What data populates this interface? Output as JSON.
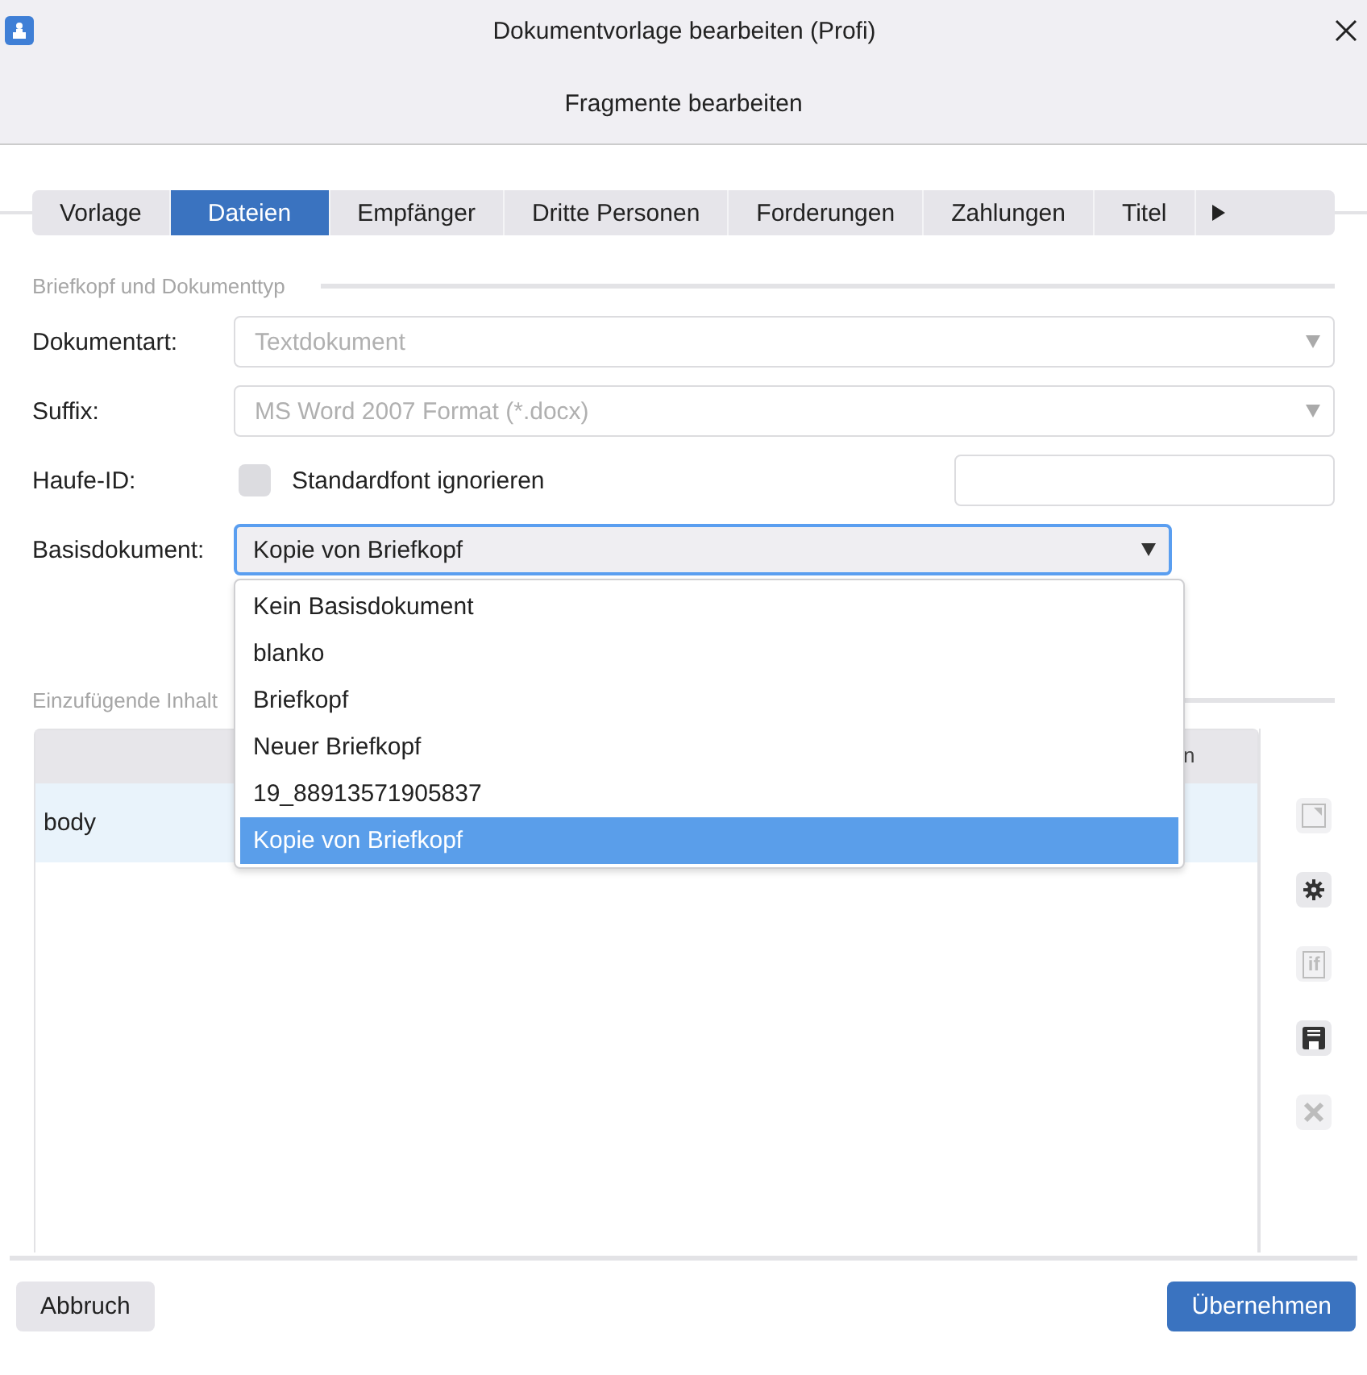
{
  "window": {
    "title": "Dokumentvorlage bearbeiten (Profi)",
    "subtitle": "Fragmente bearbeiten"
  },
  "tabs": [
    {
      "label": "Vorlage",
      "selected": false
    },
    {
      "label": "Dateien",
      "selected": true
    },
    {
      "label": "Empfänger",
      "selected": false
    },
    {
      "label": "Dritte Personen",
      "selected": false
    },
    {
      "label": "Forderungen",
      "selected": false
    },
    {
      "label": "Zahlungen",
      "selected": false
    },
    {
      "label": "Titel",
      "selected": false
    }
  ],
  "section_1": "Briefkopf und Dokumenttyp",
  "fields": [
    {
      "kind": "select",
      "label": "Dokumentart:",
      "value": "Textdokument",
      "disabled": true
    },
    {
      "kind": "select",
      "label": "Suffix:",
      "value": "MS Word 2007 Format (*.docx)",
      "disabled": true
    },
    {
      "kind": "checkbox",
      "label": "Haufe-ID:",
      "checkbox_label": "Standardfont ignorieren",
      "checked": false
    },
    {
      "kind": "select",
      "label": "Basisdokument:",
      "value": "Kopie von Briefkopf",
      "disabled": false,
      "expanded": true,
      "options": [
        {
          "label": "Kein Basisdokument",
          "selected": false
        },
        {
          "label": "blanko",
          "selected": false
        },
        {
          "label": "Briefkopf",
          "selected": false
        },
        {
          "label": "Neuer Briefkopf",
          "selected": false
        },
        {
          "label": "19_88913571905837",
          "selected": false
        },
        {
          "label": "Kopie von Briefkopf",
          "selected": true
        }
      ]
    }
  ],
  "section_2": "Einzufügende Inhalt",
  "table": {
    "column_2": "n",
    "rows": [
      {
        "cells": [
          "body"
        ],
        "selected": true
      }
    ]
  },
  "side_buttons": [
    {
      "kind": "corner",
      "disabled": true
    },
    {
      "kind": "gear",
      "disabled": false
    },
    {
      "kind": "if",
      "label": "if",
      "disabled": true
    },
    {
      "kind": "save",
      "disabled": false
    },
    {
      "kind": "delete",
      "disabled": true
    }
  ],
  "buttons": [
    {
      "label": "Abbruch",
      "primary": false
    },
    {
      "label": "Übernehmen",
      "primary": true
    }
  ]
}
